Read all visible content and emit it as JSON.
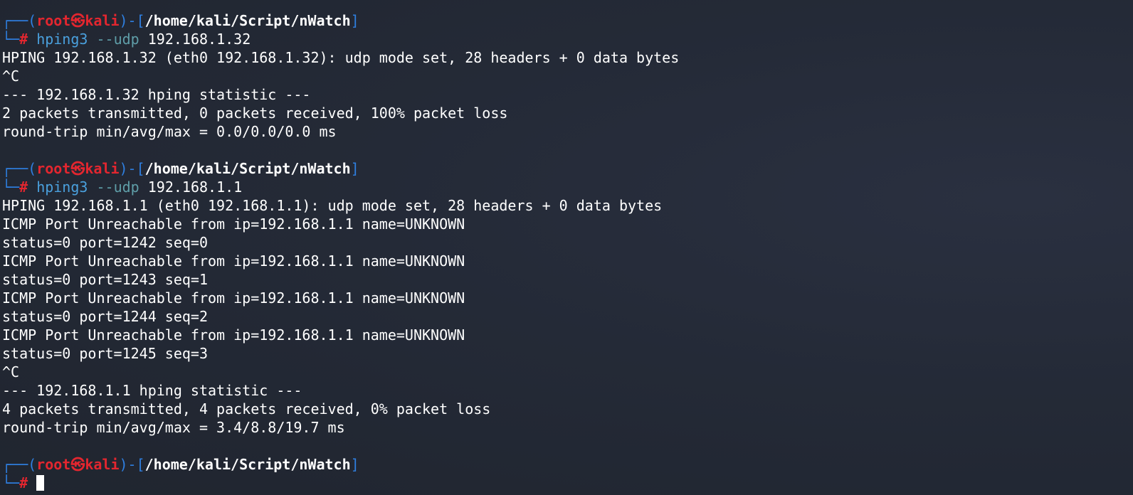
{
  "prompt": {
    "top_left": "┌──(",
    "user": "root",
    "at_symbol": "㉿",
    "host": "kali",
    "sep": ")-[",
    "path": "/home/kali/Script/nWatch",
    "close": "]",
    "bottom_left": "└─",
    "hash": "#"
  },
  "session1": {
    "cmd": "hping3",
    "opt": "--udp",
    "arg": "192.168.1.32",
    "output": [
      "HPING 192.168.1.32 (eth0 192.168.1.32): udp mode set, 28 headers + 0 data bytes",
      "^C",
      "--- 192.168.1.32 hping statistic ---",
      "2 packets transmitted, 0 packets received, 100% packet loss",
      "round-trip min/avg/max = 0.0/0.0/0.0 ms"
    ]
  },
  "session2": {
    "cmd": "hping3",
    "opt": "--udp",
    "arg": "192.168.1.1",
    "output": [
      "HPING 192.168.1.1 (eth0 192.168.1.1): udp mode set, 28 headers + 0 data bytes",
      "ICMP Port Unreachable from ip=192.168.1.1 name=UNKNOWN",
      "status=0 port=1242 seq=0",
      "ICMP Port Unreachable from ip=192.168.1.1 name=UNKNOWN",
      "status=0 port=1243 seq=1",
      "ICMP Port Unreachable from ip=192.168.1.1 name=UNKNOWN",
      "status=0 port=1244 seq=2",
      "ICMP Port Unreachable from ip=192.168.1.1 name=UNKNOWN",
      "status=0 port=1245 seq=3",
      "^C",
      "--- 192.168.1.1 hping statistic ---",
      "4 packets transmitted, 4 packets received, 0% packet loss",
      "round-trip min/avg/max = 3.4/8.8/19.7 ms"
    ]
  },
  "colors": {
    "background": "#242a37",
    "prompt_frame": "#2f7fe0",
    "prompt_user": "#e3262f",
    "command": "#4aa0dd",
    "option": "#5f9ea8",
    "text": "#ffffff"
  }
}
